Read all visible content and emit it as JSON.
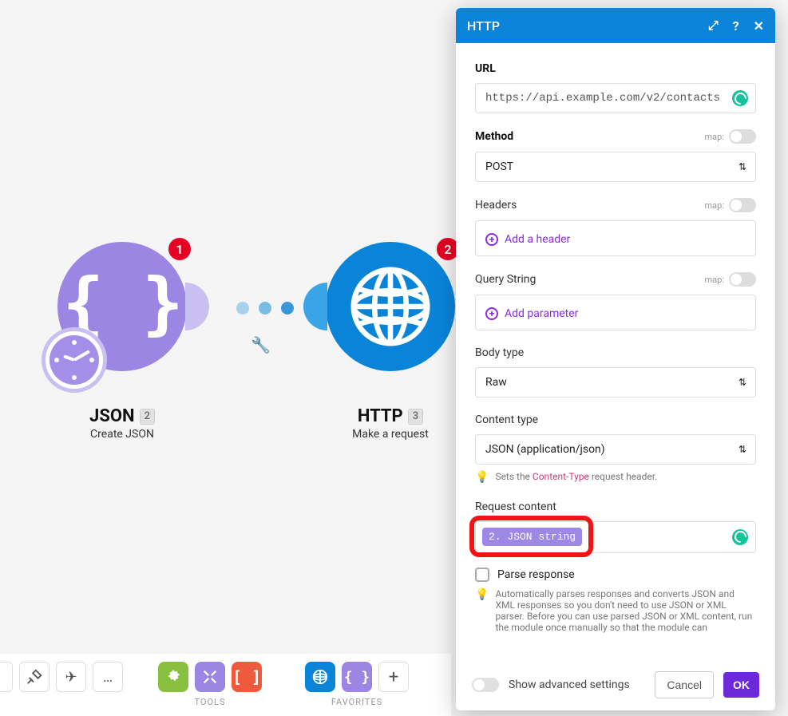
{
  "panel": {
    "title": "HTTP",
    "url_label": "URL",
    "url_value": "https://api.example.com/v2/contacts",
    "method_label": "Method",
    "method_value": "POST",
    "headers_label": "Headers",
    "add_header": "Add a header",
    "query_label": "Query String",
    "add_param": "Add parameter",
    "body_type_label": "Body type",
    "body_type_value": "Raw",
    "content_type_label": "Content type",
    "content_type_value": "JSON (application/json)",
    "content_type_hint_prefix": "Sets the ",
    "content_type_hint_code": "Content-Type",
    "content_type_hint_suffix": " request header.",
    "request_content_label": "Request content",
    "request_content_pill": "2. JSON string",
    "parse_label": "Parse response",
    "parse_hint": "Automatically parses responses and converts JSON and XML responses so you don't need to use JSON or XML parser. Before you can use parsed JSON or XML content, run the module once manually so that the module can",
    "map_label": "map:",
    "advanced_label": "Show advanced settings",
    "cancel": "Cancel",
    "ok": "OK"
  },
  "nodes": {
    "json": {
      "title": "JSON",
      "num": "2",
      "sub": "Create JSON",
      "badge": "1"
    },
    "http": {
      "title": "HTTP",
      "num": "3",
      "sub": "Make a request",
      "badge": "2"
    }
  },
  "toolbar": {
    "tools_label": "TOOLS",
    "favorites_label": "FAVORITES",
    "more": "…"
  }
}
